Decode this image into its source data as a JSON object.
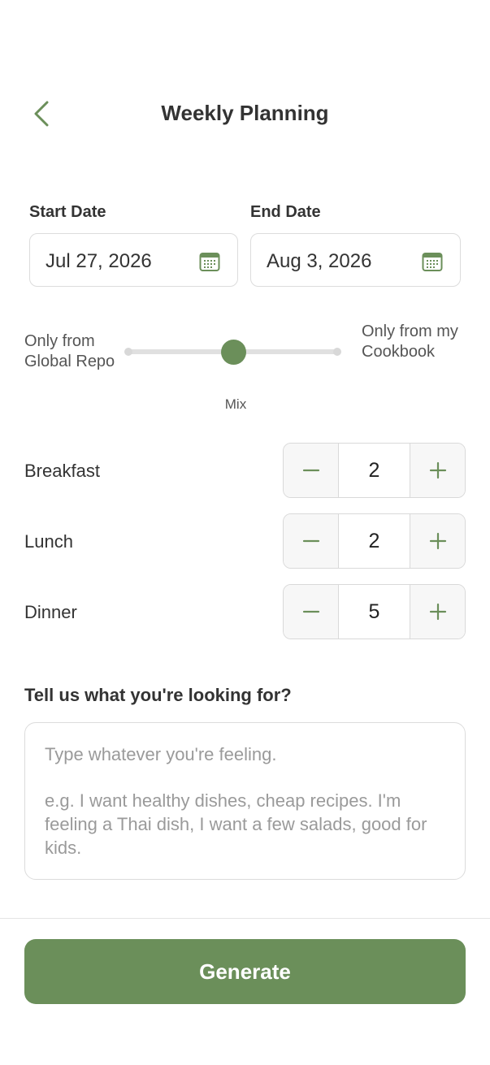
{
  "header": {
    "title": "Weekly Planning",
    "back_icon": "chevron-left-icon"
  },
  "dates": {
    "start_label": "Start Date",
    "start_value": "Jul 27, 2026",
    "end_label": "End Date",
    "end_value": "Aug 3, 2026",
    "icon": "calendar-icon"
  },
  "source_slider": {
    "left_label": "Only from Global Repo",
    "right_label": "Only from my Cookbook",
    "value_label": "Mix",
    "value_fraction": 0.5
  },
  "meals": [
    {
      "label": "Breakfast",
      "count": "2"
    },
    {
      "label": "Lunch",
      "count": "2"
    },
    {
      "label": "Dinner",
      "count": "5"
    }
  ],
  "preferences": {
    "question": "Tell us what you're looking for?",
    "placeholder_line1": "Type whatever you're feeling.",
    "placeholder_line2": "e.g. I want healthy dishes, cheap recipes. I'm feeling a Thai dish, I want a few salads, good for kids."
  },
  "actions": {
    "generate_label": "Generate"
  },
  "colors": {
    "accent": "#6b8f5a",
    "border": "#dcdcdc",
    "text": "#333333"
  }
}
